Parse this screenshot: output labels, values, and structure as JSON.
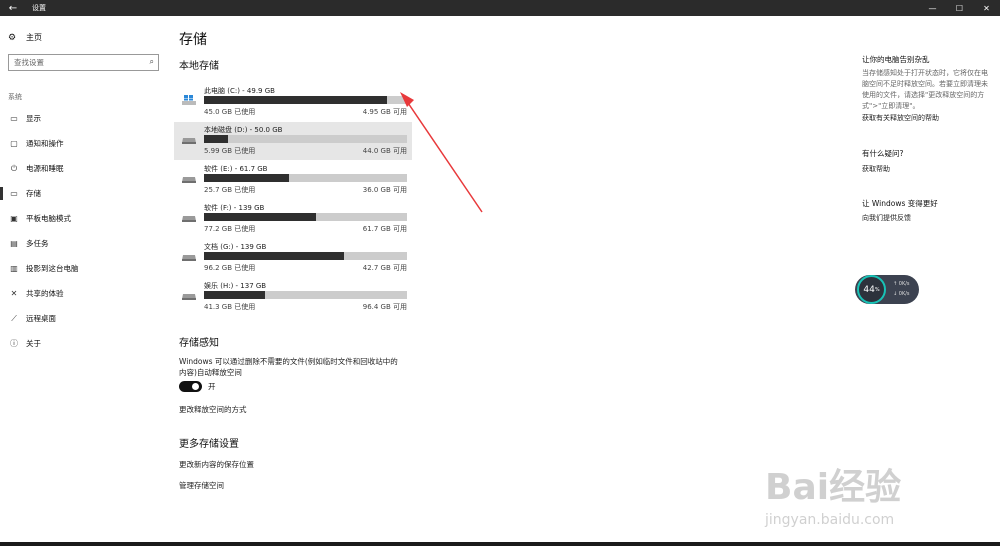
{
  "window": {
    "title": "设置",
    "back_icon": "arrow-left-icon",
    "controls": {
      "minimize": "—",
      "maximize": "☐",
      "close": "✕"
    }
  },
  "sidebar": {
    "home": "主页",
    "search_placeholder": "查找设置",
    "section": "系统",
    "items": [
      {
        "label": "显示",
        "icon": "monitor-icon",
        "glyph": "▭"
      },
      {
        "label": "通知和操作",
        "icon": "notification-icon",
        "glyph": "▢"
      },
      {
        "label": "电源和睡眠",
        "icon": "power-icon",
        "glyph": "⏻"
      },
      {
        "label": "存储",
        "icon": "storage-icon",
        "glyph": "▭"
      },
      {
        "label": "平板电脑模式",
        "icon": "tablet-mode-icon",
        "glyph": "▣"
      },
      {
        "label": "多任务",
        "icon": "multitask-icon",
        "glyph": "▤"
      },
      {
        "label": "投影到这台电脑",
        "icon": "project-icon",
        "glyph": "▥"
      },
      {
        "label": "共享的体验",
        "icon": "shared-experience-icon",
        "glyph": "✕"
      },
      {
        "label": "远程桌面",
        "icon": "remote-desktop-icon",
        "glyph": "⟋"
      },
      {
        "label": "关于",
        "icon": "info-icon",
        "glyph": "ⓘ"
      }
    ],
    "active_index": 3
  },
  "main": {
    "title": "存储",
    "local_storage_heading": "本地存储",
    "drives": [
      {
        "name": "此电脑 (C:) - 49.9 GB",
        "used": "45.0 GB 已使用",
        "free": "4.95 GB 可用",
        "used_fraction": 0.9,
        "icon": "windows-drive-icon"
      },
      {
        "name": "本地磁盘 (D:) - 50.0 GB",
        "used": "5.99 GB 已使用",
        "free": "44.0 GB 可用",
        "used_fraction": 0.12,
        "icon": "drive-icon"
      },
      {
        "name": "软件 (E:) - 61.7 GB",
        "used": "25.7 GB 已使用",
        "free": "36.0 GB 可用",
        "used_fraction": 0.42,
        "icon": "drive-icon"
      },
      {
        "name": "软件 (F:) - 139 GB",
        "used": "77.2 GB 已使用",
        "free": "61.7 GB 可用",
        "used_fraction": 0.55,
        "icon": "drive-icon"
      },
      {
        "name": "文档 (G:) - 139 GB",
        "used": "96.2 GB 已使用",
        "free": "42.7 GB 可用",
        "used_fraction": 0.69,
        "icon": "drive-icon"
      },
      {
        "name": "娱乐 (H:) - 137 GB",
        "used": "41.3 GB 已使用",
        "free": "96.4 GB 可用",
        "used_fraction": 0.3,
        "icon": "drive-icon"
      }
    ],
    "storage_sense_heading": "存储感知",
    "storage_sense_desc_line1": "Windows 可以通过删除不需要的文件(例如临时文件和回收站中的",
    "storage_sense_desc_line2": "内容)自动释放空间",
    "toggle_label": "开",
    "change_free_space_link": "更改释放空间的方式",
    "more_settings_heading": "更多存储设置",
    "change_save_location_link": "更改新内容的保存位置",
    "manage_spaces_link": "管理存储空间"
  },
  "right_panel": {
    "heading1": "让你的电脑告别杂乱",
    "desc1": "当存储感知处于打开状态时，它将仅在电脑空间不足时释放空间。若要立即清理未使用的文件，请选择\"更改释放空间的方式\">\"立即清理\"。",
    "link1": "获取有关释放空间的帮助",
    "heading2": "有什么疑问?",
    "link2": "获取帮助",
    "heading3": "让 Windows 变得更好",
    "link3": "向我们提供反馈"
  },
  "widget": {
    "percent": "44",
    "unit": "%",
    "up": "0K/s",
    "down": "0K/s"
  },
  "watermark": {
    "logo": "Bai经验",
    "url": "jingyan.baidu.com"
  },
  "colors": {
    "bar_fill": "#2f2f2f",
    "bar_bg": "#cccccc",
    "arrow": "#e8393b",
    "widget_ring": "#18c2b6"
  }
}
